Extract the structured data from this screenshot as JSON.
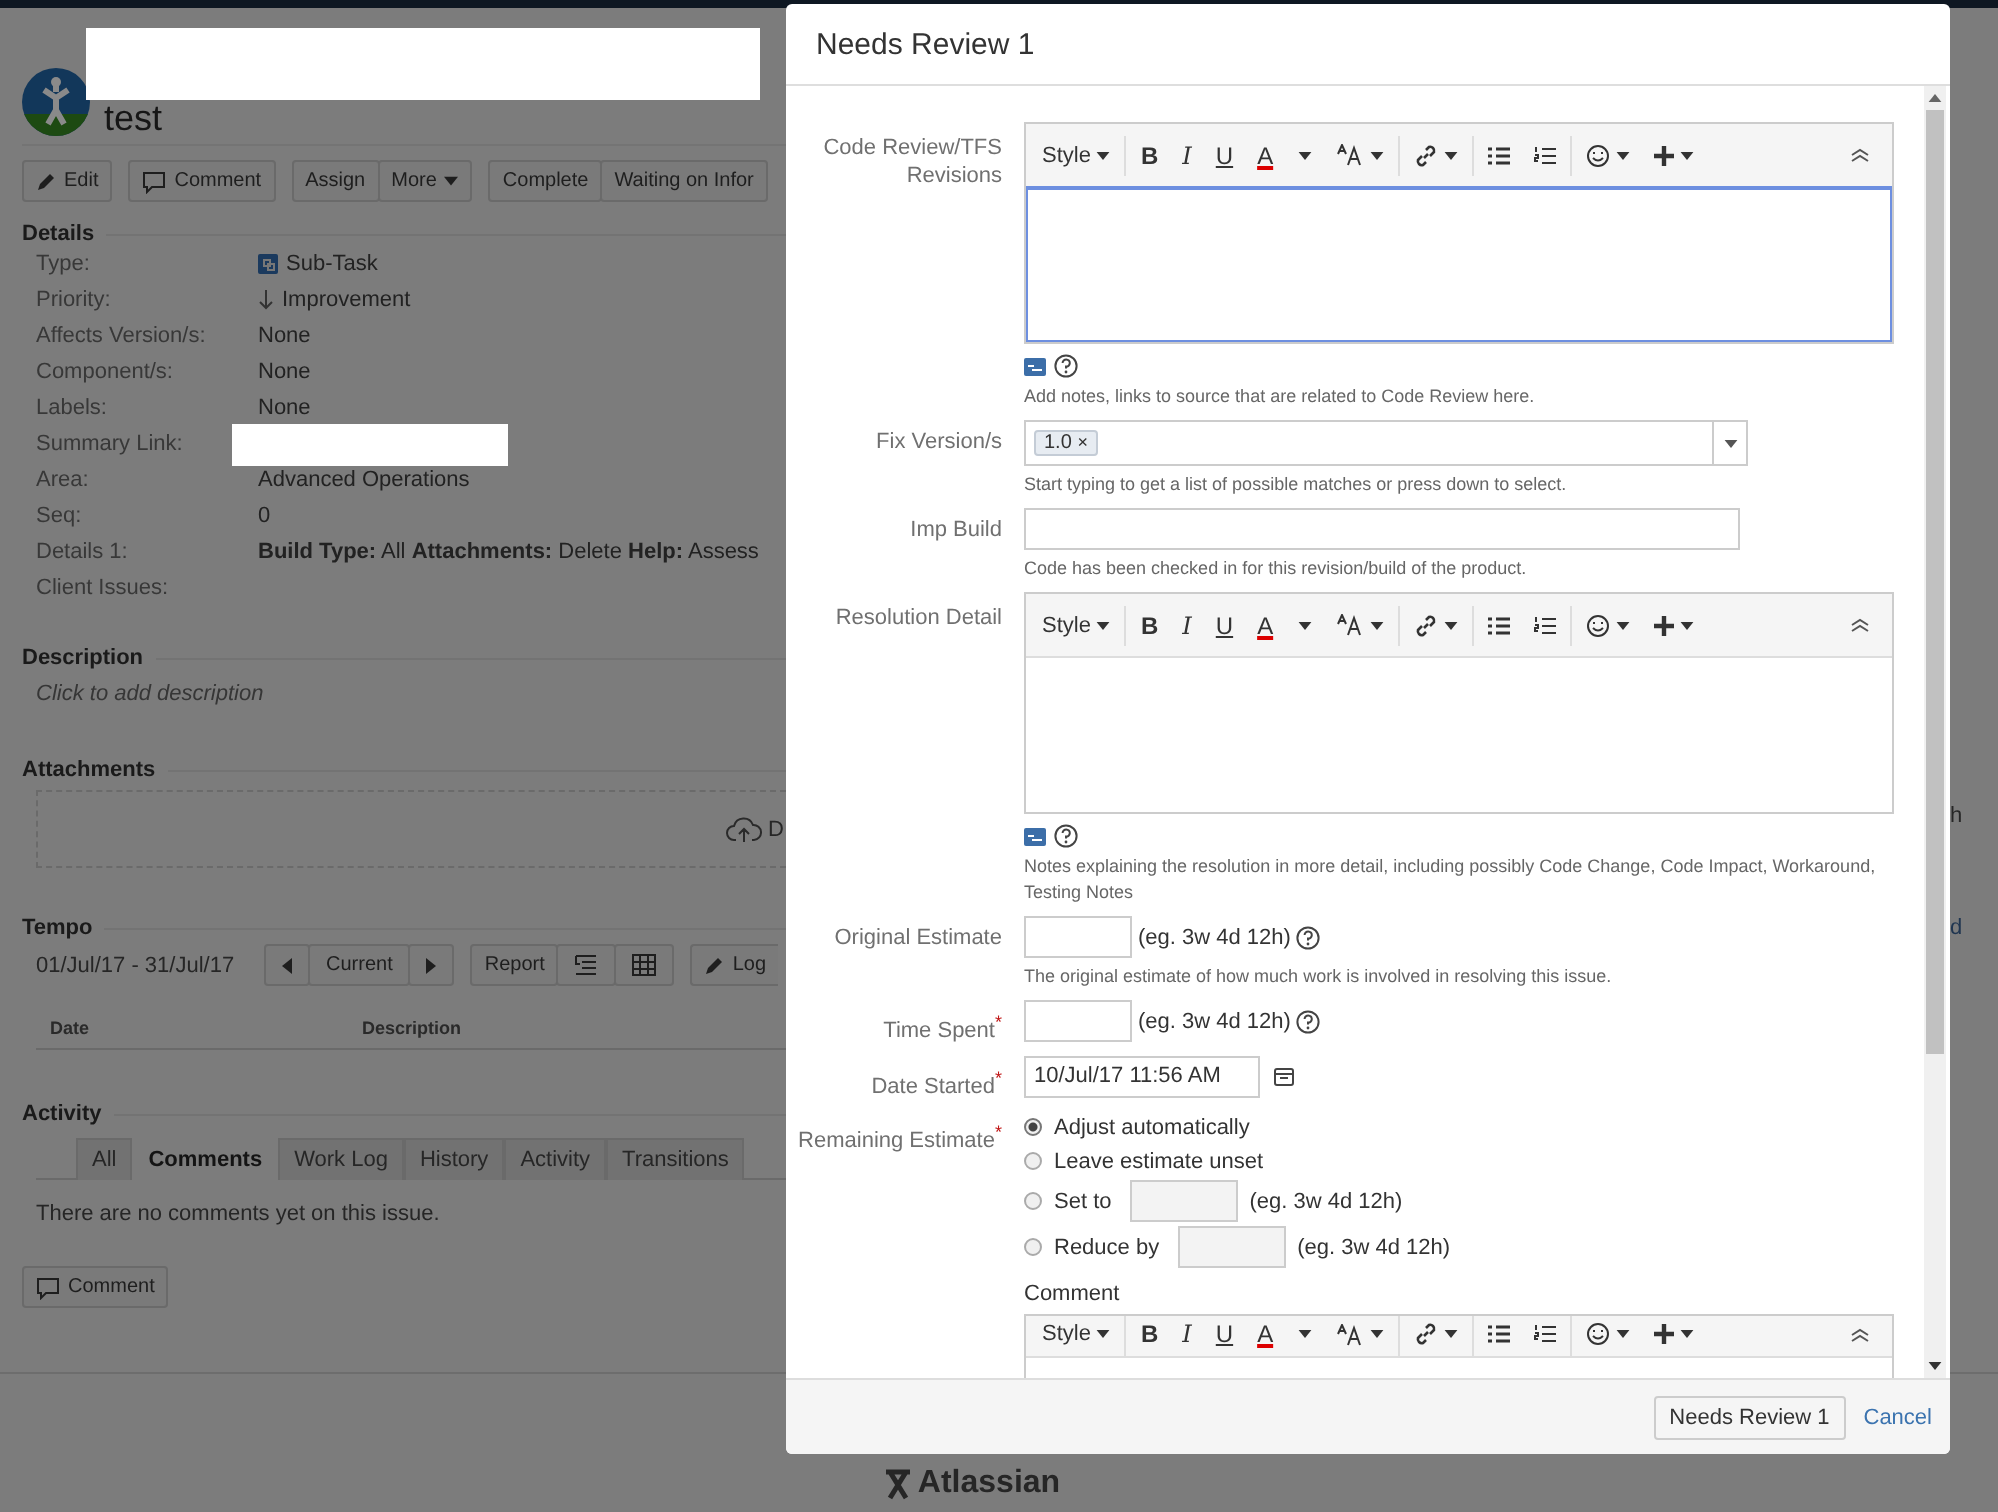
{
  "issue": {
    "title": "test",
    "actions": [
      [
        {
          "label": "Edit",
          "kind": "edit"
        }
      ],
      [
        {
          "label": "Comment",
          "kind": "comment"
        }
      ],
      [
        {
          "label": "Assign",
          "kind": "plain"
        },
        {
          "label": "More",
          "kind": "dropdown"
        }
      ],
      [
        {
          "label": "Complete",
          "kind": "plain"
        },
        {
          "label": "Waiting on Infor",
          "kind": "plain"
        }
      ]
    ],
    "details": {
      "title": "Details",
      "fields": [
        {
          "label": "Type:",
          "value": "Sub-Task",
          "kind": "type"
        },
        {
          "label": "Priority:",
          "value": "Improvement",
          "kind": "priority"
        },
        {
          "label": "Affects Version/s:",
          "value": "None",
          "kind": "text"
        },
        {
          "label": "Component/s:",
          "value": "None",
          "kind": "text"
        },
        {
          "label": "Labels:",
          "value": "None",
          "kind": "text"
        },
        {
          "label": "Summary Link:",
          "kind": "redacted"
        },
        {
          "label": "Area:",
          "value": "Advanced Operations",
          "kind": "text"
        },
        {
          "label": "Seq:",
          "value": "0",
          "kind": "text"
        },
        {
          "label": "Details 1:",
          "value": "**Build Type:** All **Attachments:** Delete **Help:** Assess",
          "kind": "text"
        },
        {
          "label": "Client Issues:",
          "kind": "empty"
        }
      ]
    },
    "description": {
      "title": "Description",
      "hint": "Click to add description"
    },
    "attachments": {
      "title": "Attachments",
      "drop_text": "D"
    },
    "tempo": {
      "title": "Tempo",
      "range": "01/Jul/17 - 31/Jul/17",
      "period": "Current",
      "report": "Report",
      "log": "Log",
      "columns": [
        "Date",
        "Description"
      ]
    },
    "activity": {
      "title": "Activity",
      "tabs": [
        {
          "label": "All",
          "selected": false
        },
        {
          "label": "Comments",
          "selected": true
        },
        {
          "label": "Work Log",
          "selected": false
        },
        {
          "label": "History",
          "selected": false
        },
        {
          "label": "Activity",
          "selected": false
        },
        {
          "label": "Transitions",
          "selected": false
        }
      ],
      "empty": "There are no comments yet on this issue.",
      "button": "Comment"
    }
  },
  "behind_fragments": [
    {
      "text": "h",
      "kind": "text"
    },
    {
      "text": "d",
      "kind": "link"
    }
  ],
  "footer_logo": "Atlassian",
  "dialog": {
    "title": "Needs Review 1",
    "fields": [
      {
        "kind": "editor",
        "label": "Code Review/TFS Revisions",
        "style_label": "Style",
        "format_buttons": [
          "B",
          "I",
          "U",
          "A"
        ],
        "help": "Add notes, links to source that are related to Code Review here.",
        "focused": true
      },
      {
        "kind": "multiselect",
        "label": "Fix Version/s",
        "chips": [
          "1.0"
        ],
        "chip_remove": "×",
        "help": "Start typing to get a list of possible matches or press down to select."
      },
      {
        "kind": "text",
        "label": "Imp Build",
        "help": "Code has been checked in for this revision/build of the product."
      },
      {
        "kind": "editor",
        "label": "Resolution Detail",
        "style_label": "Style",
        "format_buttons": [
          "B",
          "I",
          "U",
          "A"
        ],
        "help": "Notes explaining the resolution in more detail, including possibly Code Change, Code Impact, Workaround, Testing Notes",
        "focused": false
      },
      {
        "kind": "duration",
        "label": "Original Estimate",
        "example": "(eg. 3w 4d 12h)",
        "help": "The original estimate of how much work is involved in resolving this issue."
      },
      {
        "kind": "duration",
        "label": "Time Spent",
        "required_mark": "*",
        "example": "(eg. 3w 4d 12h)"
      },
      {
        "kind": "date",
        "label": "Date Started",
        "required_mark": "*",
        "value": "10/Jul/17 11:56 AM"
      },
      {
        "kind": "radios",
        "label": "Remaining Estimate",
        "required_mark": "*",
        "options": [
          {
            "label": "Adjust automatically",
            "selected": true,
            "kind": "plain"
          },
          {
            "label": "Leave estimate unset",
            "selected": false,
            "kind": "plain"
          },
          {
            "label": "Set to",
            "selected": false,
            "kind": "duration",
            "example": "(eg. 3w 4d 12h)"
          },
          {
            "label": "Reduce by",
            "selected": false,
            "kind": "duration",
            "example": "(eg. 3w 4d 12h)"
          }
        ]
      },
      {
        "kind": "editor_stacked",
        "label": "Comment",
        "style_label": "Style",
        "format_buttons": [
          "B",
          "I",
          "U",
          "A"
        ]
      }
    ],
    "submit": "Needs Review 1",
    "cancel": "Cancel"
  }
}
